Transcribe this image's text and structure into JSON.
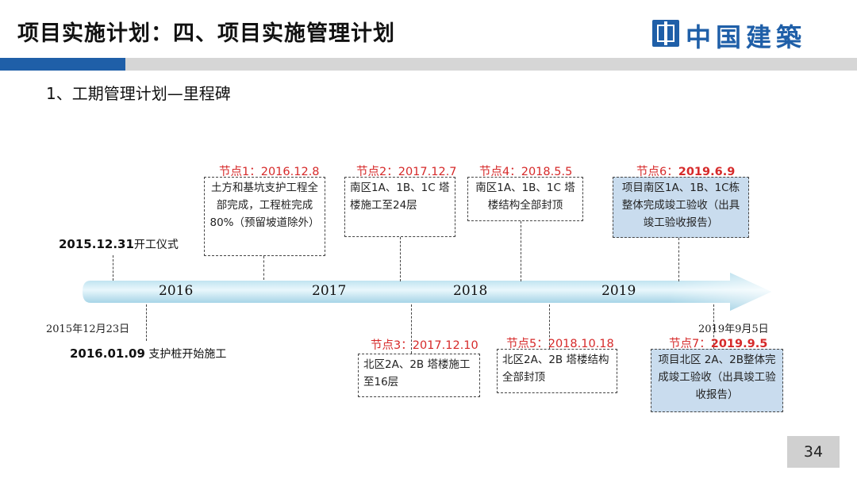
{
  "header": {
    "title": "项目实施计划：四、项目实施管理计划",
    "brand": "中国建築",
    "brand_color": "#1f5fa8"
  },
  "subtitle": "1、工期管理计划—里程碑",
  "timeline": {
    "years": [
      "2016",
      "2017",
      "2018",
      "2019"
    ]
  },
  "events": {
    "start": {
      "date": "2015.12.31",
      "text": "开工仪式"
    },
    "date_small": "2015年12月23日",
    "pile": {
      "date": "2016.01.09",
      "text": "支护桩开始施工"
    },
    "date_small_right": "2019年9月5日"
  },
  "nodes": {
    "n1": {
      "prefix": "节点1：",
      "date": "2016.12.8",
      "text": "土方和基坑支护工程全部完成，工程桩完成80%（预留坡道除外）"
    },
    "n2": {
      "prefix": "节点2：",
      "date": "2017.12.7",
      "text": "南区1A、1B、1C 塔楼施工至24层"
    },
    "n3": {
      "prefix": "节点3：",
      "date": "2017.12.10",
      "text": "北区2A、2B 塔楼施工至16层"
    },
    "n4": {
      "prefix": "节点4：",
      "date": "2018.5.5",
      "text": "南区1A、1B、1C 塔楼结构全部封顶"
    },
    "n5": {
      "prefix": "节点5：",
      "date": "2018.10.18",
      "text": "北区2A、2B 塔楼结构全部封顶"
    },
    "n6": {
      "prefix": "节点6：",
      "date": "2019.6.9",
      "text": "项目南区1A、1B、1C栋整体完成竣工验收（出具竣工验收报告）"
    },
    "n7": {
      "prefix": "节点7：",
      "date": "2019.9.5",
      "text": "项目北区 2A、2B整体完成竣工验收（出具竣工验收报告）"
    }
  },
  "page_number": "34"
}
